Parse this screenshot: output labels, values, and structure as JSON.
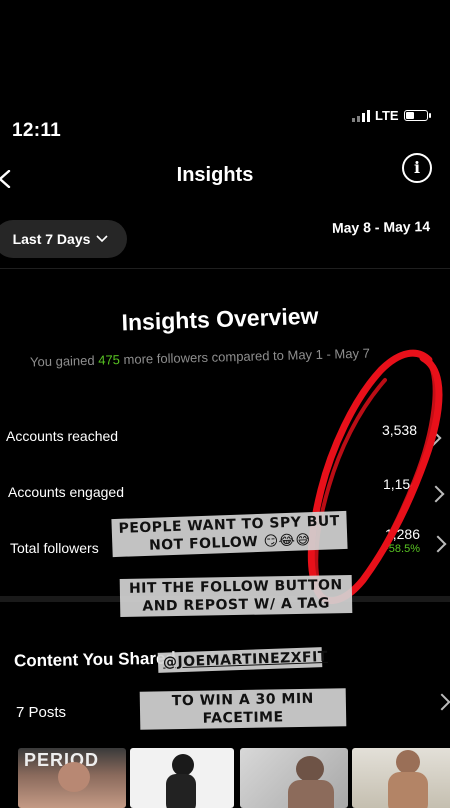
{
  "status_bar": {
    "time": "12:11",
    "network": "LTE"
  },
  "header": {
    "title": "Insights"
  },
  "filter": {
    "range_label": "Last 7 Days",
    "date_range": "May 8 - May 14"
  },
  "overview": {
    "title": "Insights Overview",
    "subtitle_prefix": "You gained ",
    "followers_gained": "475",
    "subtitle_suffix": " more followers compared to May 1 - May 7"
  },
  "metrics": [
    {
      "label": "Accounts reached",
      "value": "3,538"
    },
    {
      "label": "Accounts engaged",
      "value": "1,154"
    },
    {
      "label": "Total followers",
      "value": "1,286",
      "change": "+58.5%"
    }
  ],
  "content": {
    "title": "Content You Shared",
    "posts_label": "7 Posts"
  },
  "stickers": [
    {
      "text": "PEOPLE WANT TO SPY BUT NOT FOLLOW 😏😂😅"
    },
    {
      "text": "HIT THE FOLLOW BUTTON AND REPOST W/ A TAG"
    },
    {
      "text": "@JOEMARTINEZXFIT"
    },
    {
      "text": "TO WIN A 30 MIN FACETIME"
    }
  ],
  "thumbnail_overlay_text": "PERIOD",
  "colors": {
    "positive": "#58c322",
    "scribble": "#e8101a",
    "sticker_bg": "#d2d2d2"
  }
}
